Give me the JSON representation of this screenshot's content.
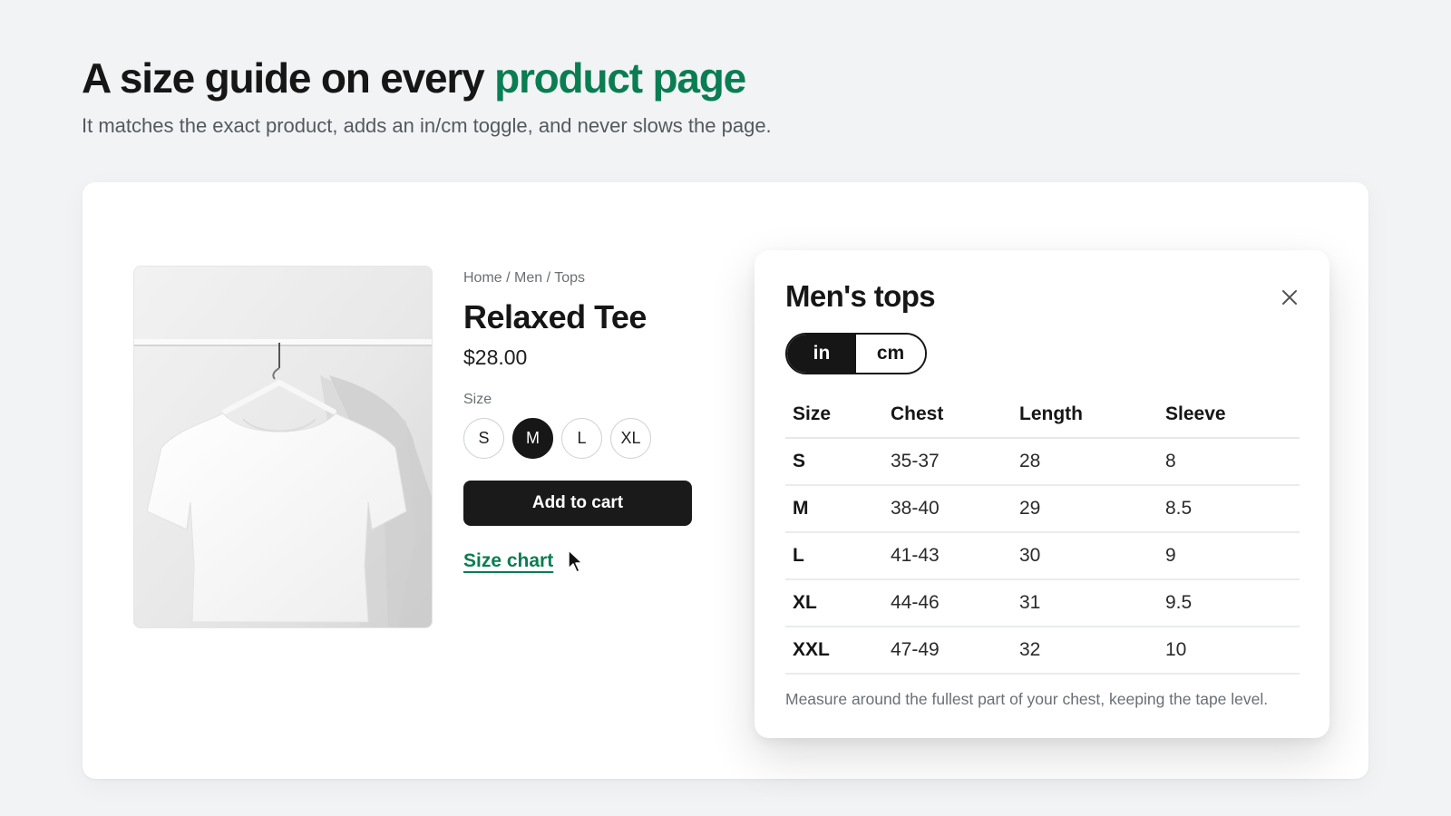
{
  "header": {
    "title_plain": "A size guide on every ",
    "title_accent": "product page",
    "subtitle": "It matches the exact product, adds an in/cm toggle, and never slows the page.",
    "accent_color": "#0a7d52"
  },
  "product": {
    "breadcrumb": "Home / Men / Tops",
    "title": "Relaxed Tee",
    "price": "$28.00",
    "size_label": "Size",
    "sizes": [
      "S",
      "M",
      "L",
      "XL"
    ],
    "selected_size": "M",
    "add_to_cart_label": "Add to cart",
    "size_chart_link": "Size chart",
    "image_icon": "white-tshirt-on-hanger"
  },
  "size_guide": {
    "title": "Men's tops",
    "close_icon": "close-icon",
    "units": [
      "in",
      "cm"
    ],
    "active_unit": "in",
    "columns": [
      "Size",
      "Chest",
      "Length",
      "Sleeve"
    ],
    "rows": [
      [
        "S",
        "35-37",
        "28",
        "8"
      ],
      [
        "M",
        "38-40",
        "29",
        "8.5"
      ],
      [
        "L",
        "41-43",
        "30",
        "9"
      ],
      [
        "XL",
        "44-46",
        "31",
        "9.5"
      ],
      [
        "XXL",
        "47-49",
        "32",
        "10"
      ]
    ],
    "footnote": "Measure around the fullest part of your chest, keeping the tape level."
  }
}
